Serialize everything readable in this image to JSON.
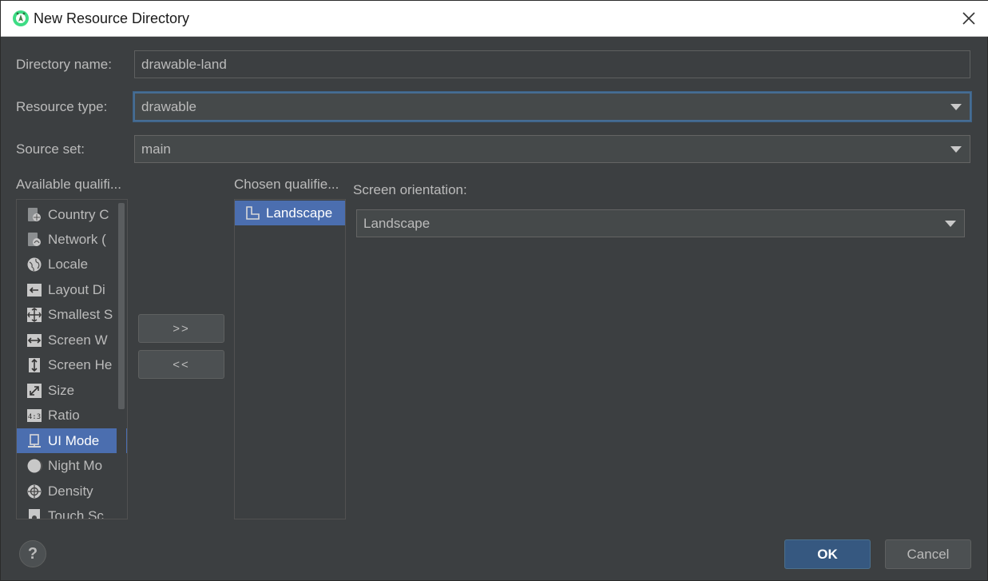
{
  "window": {
    "title": "New Resource Directory",
    "close_glyph": "✕"
  },
  "form": {
    "directory_name": {
      "label": "Directory name:",
      "value": "drawable-land"
    },
    "resource_type": {
      "label": "Resource type:",
      "value": "drawable"
    },
    "source_set": {
      "label": "Source set:",
      "value": "main"
    }
  },
  "available": {
    "label": "Available qualifi...",
    "items": [
      {
        "label": "Country C",
        "icon": "country-code-icon"
      },
      {
        "label": "Network (",
        "icon": "network-code-icon"
      },
      {
        "label": "Locale",
        "icon": "globe-icon"
      },
      {
        "label": "Layout Di",
        "icon": "layout-direction-icon"
      },
      {
        "label": "Smallest S",
        "icon": "smallest-screen-width-icon"
      },
      {
        "label": "Screen W",
        "icon": "screen-width-icon"
      },
      {
        "label": "Screen He",
        "icon": "screen-height-icon"
      },
      {
        "label": "Size",
        "icon": "size-icon"
      },
      {
        "label": "Ratio",
        "icon": "ratio-icon"
      },
      {
        "label": "UI Mode",
        "icon": "ui-mode-icon",
        "selected": true
      },
      {
        "label": "Night Mo",
        "icon": "night-mode-icon"
      },
      {
        "label": "Density",
        "icon": "density-icon"
      },
      {
        "label": "Touch Sc",
        "icon": "touch-screen-icon"
      }
    ]
  },
  "transfer": {
    "add_label": ">>",
    "remove_label": "<<"
  },
  "chosen": {
    "label": "Chosen qualifie...",
    "items": [
      {
        "label": "Landscape",
        "icon": "landscape-icon",
        "selected": true
      }
    ]
  },
  "orientation": {
    "label": "Screen orientation:",
    "value": "Landscape"
  },
  "footer": {
    "help_label": "?",
    "ok_label": "OK",
    "cancel_label": "Cancel"
  },
  "colors": {
    "background": "#3c3f41",
    "selection": "#4b6eaf",
    "primary_button": "#365880",
    "focus_border": "#466d94"
  }
}
